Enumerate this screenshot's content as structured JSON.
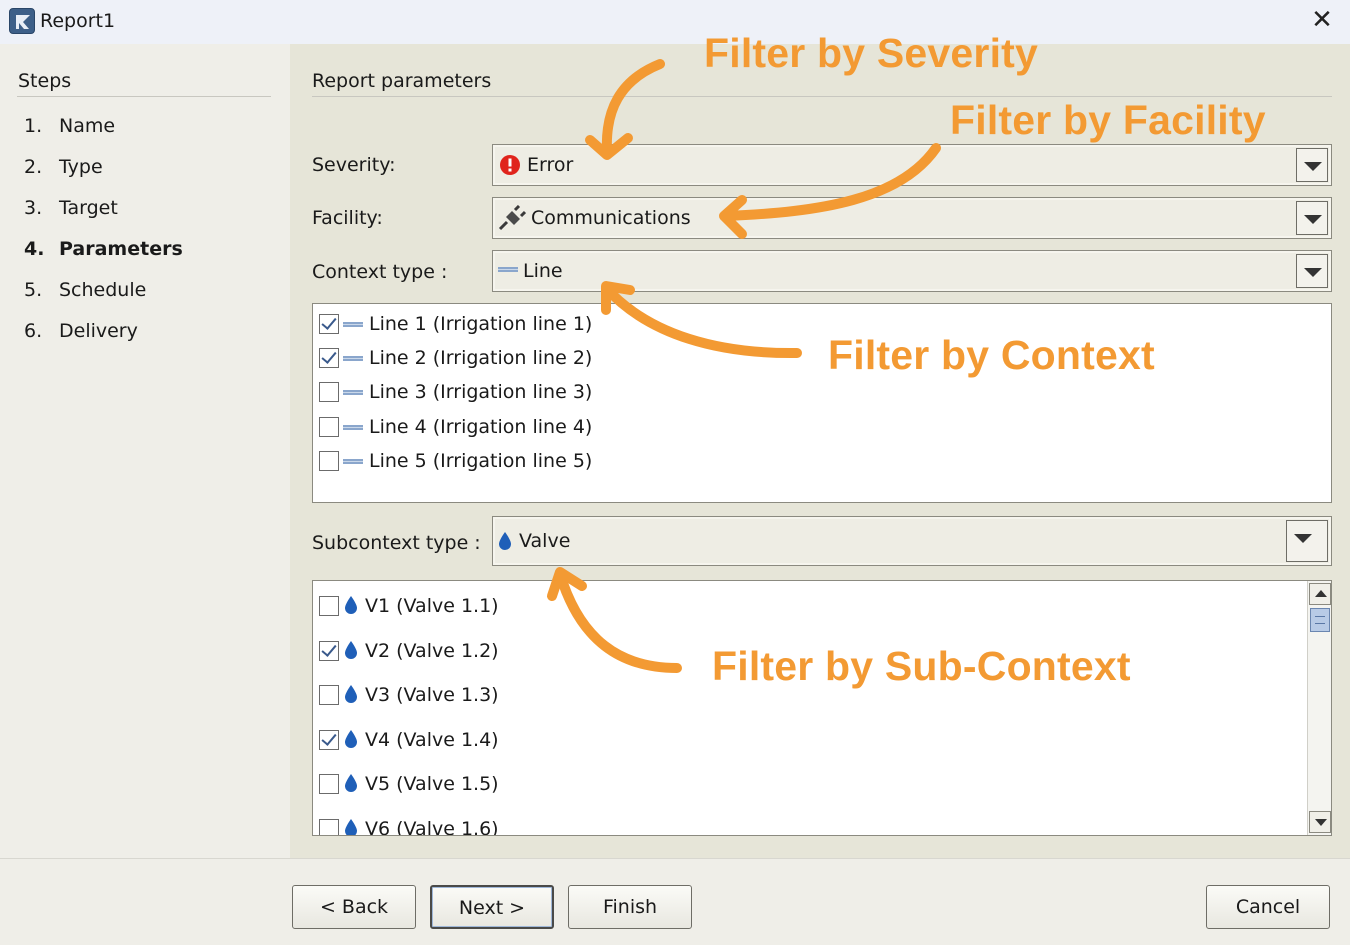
{
  "window": {
    "title": "Report1"
  },
  "sidebar": {
    "title": "Steps",
    "steps": [
      {
        "num": "1.",
        "label": "Name"
      },
      {
        "num": "2.",
        "label": "Type"
      },
      {
        "num": "3.",
        "label": "Target"
      },
      {
        "num": "4.",
        "label": "Parameters"
      },
      {
        "num": "5.",
        "label": "Schedule"
      },
      {
        "num": "6.",
        "label": "Delivery"
      }
    ],
    "active_step": 4
  },
  "main": {
    "title": "Report parameters",
    "severity": {
      "label": "Severity:",
      "value": "Error",
      "icon": "error-icon"
    },
    "facility": {
      "label": "Facility:",
      "value": "Communications",
      "icon": "plug-icon"
    },
    "context": {
      "label": "Context type :",
      "value": "Line",
      "icon": "line-icon"
    },
    "context_items": [
      {
        "label": "Line 1 (Irrigation line 1)",
        "checked": true
      },
      {
        "label": "Line 2 (Irrigation line 2)",
        "checked": true
      },
      {
        "label": "Line 3 (Irrigation line 3)",
        "checked": false
      },
      {
        "label": "Line 4 (Irrigation line 4)",
        "checked": false
      },
      {
        "label": "Line 5 (Irrigation line 5)",
        "checked": false
      }
    ],
    "subcontext": {
      "label": "Subcontext type :",
      "value": "Valve",
      "icon": "water-drop-icon"
    },
    "subcontext_items": [
      {
        "label": "V1 (Valve 1.1)",
        "checked": false
      },
      {
        "label": "V2 (Valve 1.2)",
        "checked": true
      },
      {
        "label": "V3 (Valve 1.3)",
        "checked": false
      },
      {
        "label": "V4 (Valve 1.4)",
        "checked": true
      },
      {
        "label": "V5 (Valve 1.5)",
        "checked": false
      },
      {
        "label": "V6 (Valve 1.6)",
        "checked": false
      }
    ]
  },
  "buttons": {
    "back": "< Back",
    "next": "Next >",
    "finish": "Finish",
    "cancel": "Cancel"
  },
  "annotations": {
    "severity": "Filter by Severity",
    "facility": "Filter by Facility",
    "context": "Filter by Context",
    "subcontext": "Filter by Sub-Context",
    "color": "#f39a33"
  }
}
